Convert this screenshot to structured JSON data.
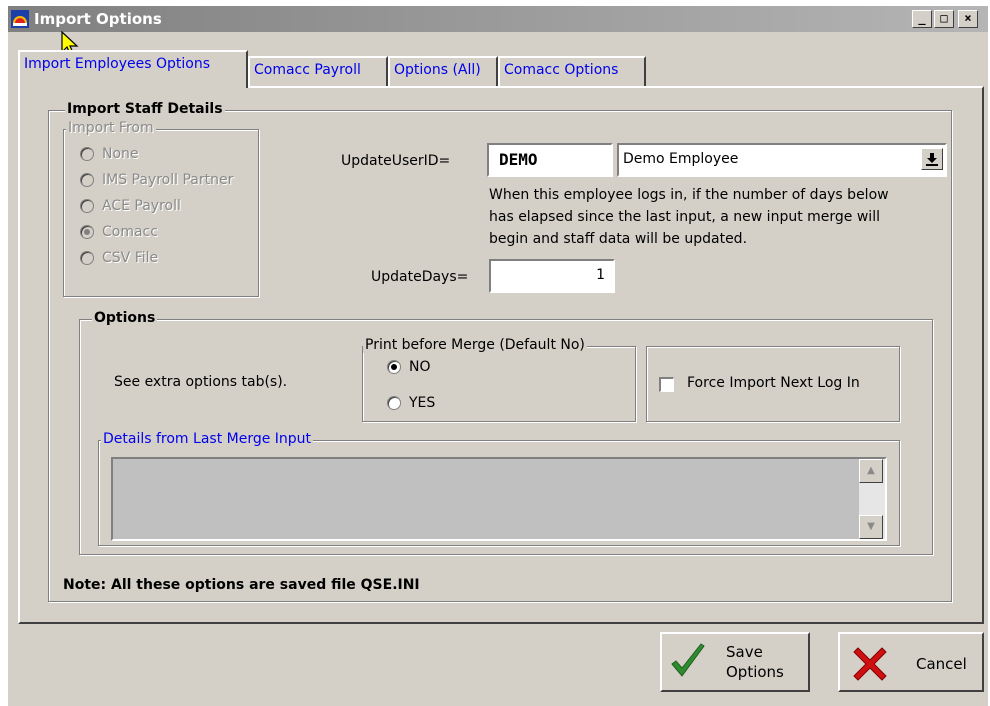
{
  "window": {
    "title": "Import Options"
  },
  "tabs": [
    {
      "label": "Import Employees Options"
    },
    {
      "label": "Comacc Payroll"
    },
    {
      "label": "Options (All)"
    },
    {
      "label": "Comacc Options"
    }
  ],
  "staff_details": {
    "title": "Import Staff Details",
    "import_from": {
      "legend": "Import From",
      "options": [
        "None",
        "IMS Payroll Partner",
        "ACE Payroll",
        "Comacc",
        "CSV File"
      ],
      "selected": "Comacc"
    },
    "update_user_id_label": "UpdateUserID=",
    "update_user_id_value": "DEMO",
    "employee_select_value": "Demo Employee",
    "help_text_lines": [
      "When this employee logs in, if the number of days below",
      "has elapsed since the last input, a new input merge will",
      "begin and staff data will be updated."
    ],
    "update_days_label": "UpdateDays=",
    "update_days_value": "1",
    "note": "Note: All these options are saved file QSE.INI"
  },
  "options": {
    "title": "Options",
    "extra_text": "See extra options tab(s).",
    "print_before_merge": {
      "legend": "Print before Merge (Default No)",
      "options": [
        "NO",
        "YES"
      ],
      "selected": "NO"
    },
    "force_import_label": "Force Import Next Log In",
    "force_import_checked": false,
    "details_legend": "Details from Last Merge Input"
  },
  "buttons": {
    "save_line1": "Save",
    "save_line2": "Options",
    "cancel": "Cancel"
  },
  "colors": {
    "tab_text": "#0000ee",
    "face": "#d4d0c8",
    "title_gradient_start": "#808080"
  }
}
